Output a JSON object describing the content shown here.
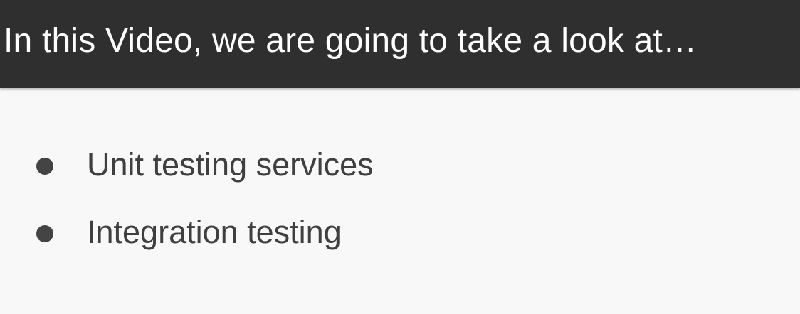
{
  "slide": {
    "title": "In this Video, we are going to take a look at…",
    "bullets": [
      {
        "label": "Unit testing services"
      },
      {
        "label": "Integration testing"
      }
    ]
  },
  "colors": {
    "title_bar": "#2f2f2f",
    "title_text": "#ffffff",
    "background": "#f8f8f8",
    "bullet_text": "#3f3f3f",
    "bullet_dot": "#444444"
  }
}
